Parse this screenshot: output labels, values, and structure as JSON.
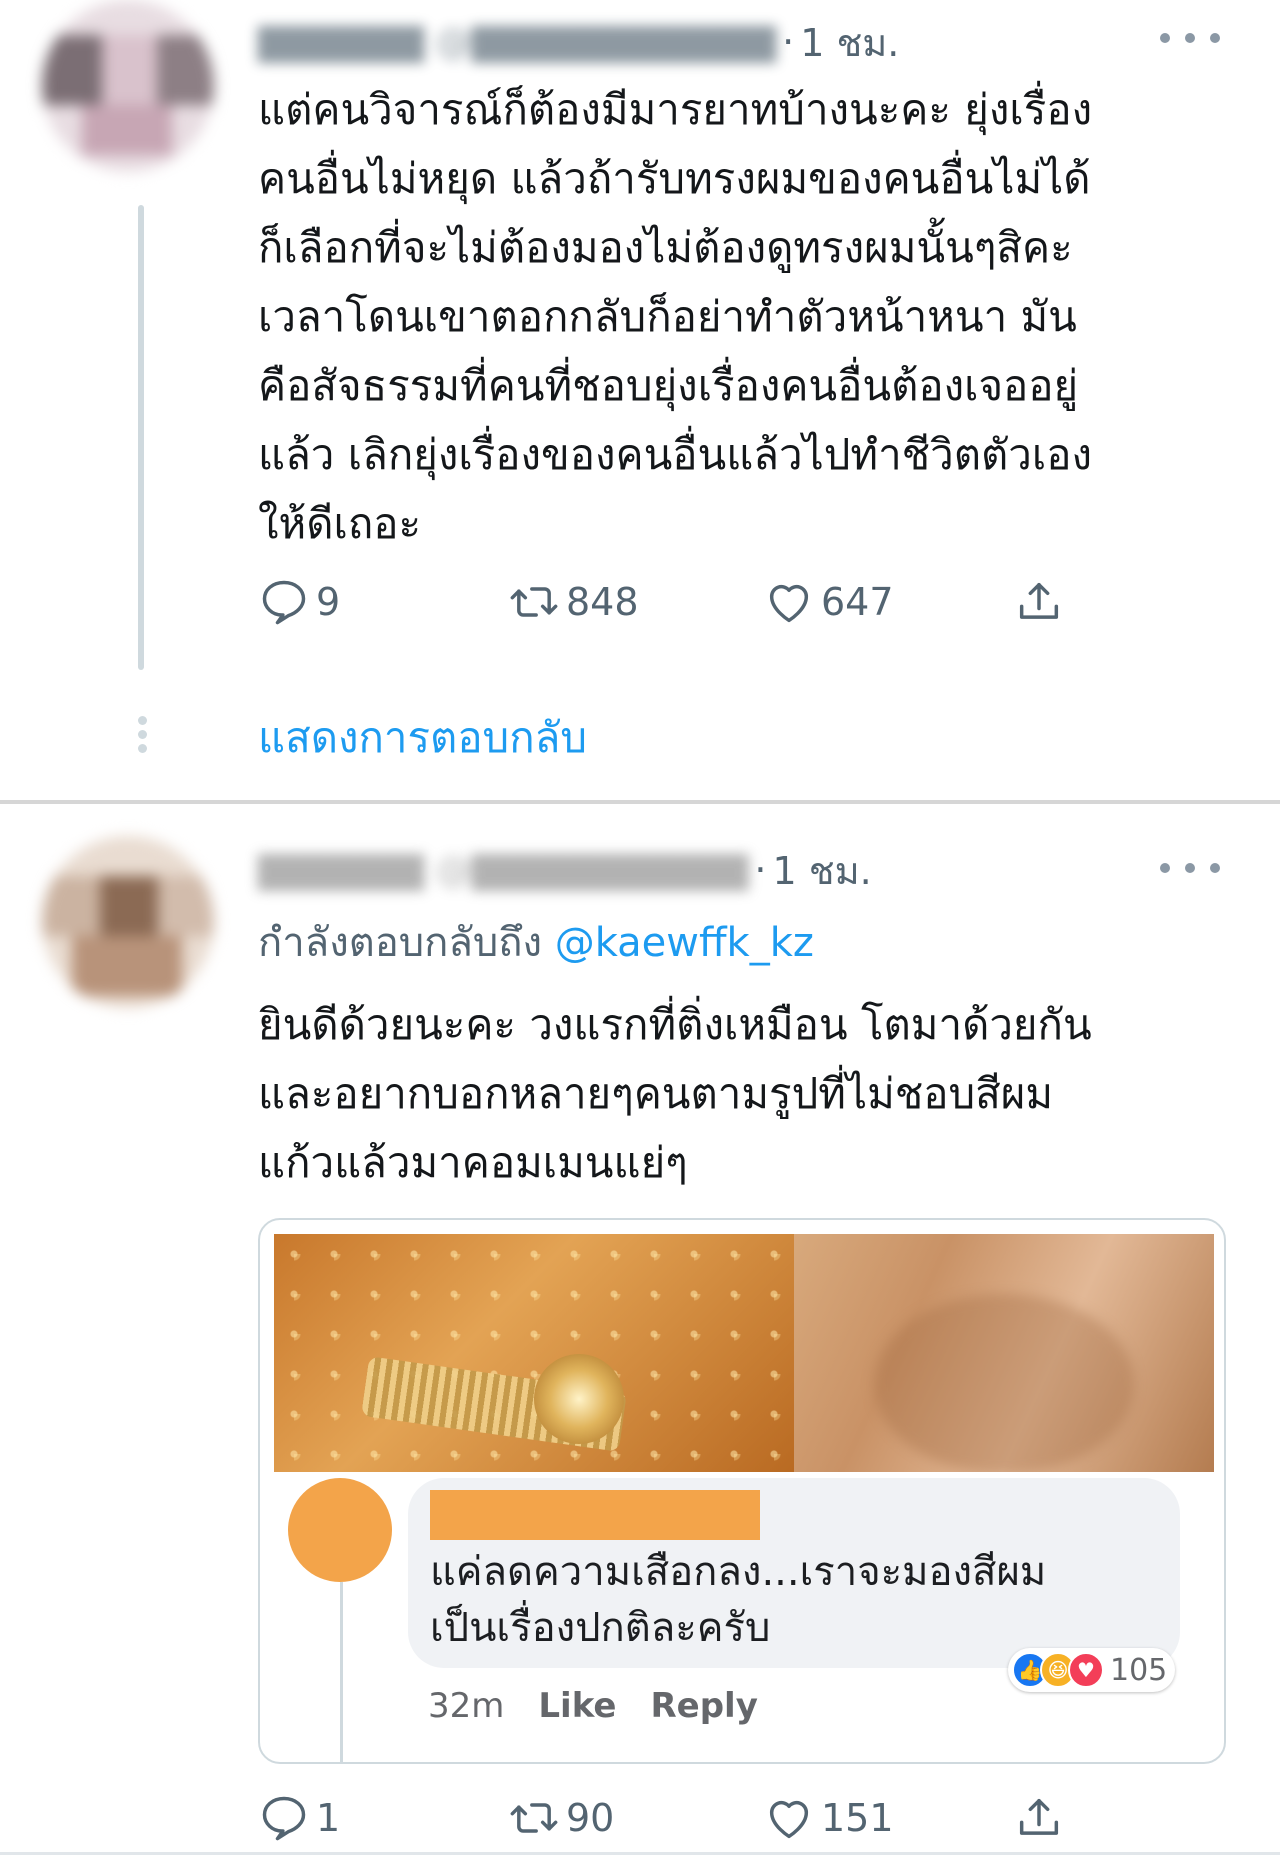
{
  "tweets": [
    {
      "time": "1 ชม.",
      "text_lines": [
        "แต่คนวิจารณ์ก็ต้องมีมารยาทบ้างนะคะ ยุ่งเรื่อง",
        "คนอื่นไม่หยุด แล้วถ้ารับทรงผมของคนอื่นไม่ได้",
        "ก็เลือกที่จะไม่ต้องมองไม่ต้องดูทรงผมนั้นๆสิคะ",
        "เวลาโดนเขาตอกกลับก็อย่าทำตัวหน้าหนา มัน",
        "คือสัจธรรมที่คนที่ชอบยุ่งเรื่องคนอื่นต้องเจออยู่",
        "แล้ว เลิกยุ่งเรื่องของคนอื่นแล้วไปทำชีวิตตัวเอง",
        "ให้ดีเถอะ"
      ],
      "replies": "9",
      "retweets": "848",
      "likes": "647",
      "show_replies": "แสดงการตอบกลับ"
    },
    {
      "time": "1 ชม.",
      "replying_prefix": "กำลังตอบกลับถึง",
      "replying_to": "@kaewffk_kz",
      "text_lines": [
        "ยินดีด้วยนะคะ  วงแรกที่ติ่งเหมือน โตมาด้วยกัน",
        "และอยากบอกหลายๆคนตามรูปที่ไม่ชอบสีผม",
        "แก้วแล้วมาคอมเมนแย่ๆ"
      ],
      "media": {
        "comment_lines": [
          "แค่ลดความเสือกลง...เราจะมองสีผม",
          "เป็นเรื่องปกติละครับ"
        ],
        "time": "32m",
        "like": "Like",
        "reply": "Reply",
        "reaction_count": "105"
      },
      "replies": "1",
      "retweets": "90",
      "likes": "151"
    }
  ],
  "icons": {
    "reply": "speech-bubble",
    "retweet": "retweet-arrows",
    "like": "heart",
    "share": "upload-arrow",
    "more": "three-dots"
  },
  "colors": {
    "accent": "#1d9bf0",
    "secondary_text": "#536471",
    "thread_line": "#cfd9de",
    "fb_avatar": "#f3a44a"
  }
}
